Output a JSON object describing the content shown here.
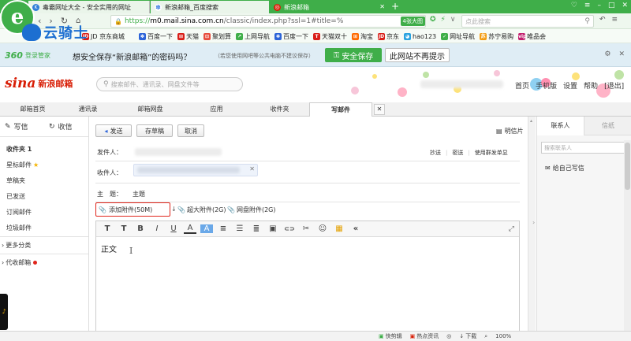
{
  "browser": {
    "tabs": [
      {
        "title": "毒霸网址大全 - 安全实用的网址",
        "icon_color": "#2f7fd8",
        "icon": "K"
      },
      {
        "title": "新浪邮箱_百度搜索",
        "icon_color": "#3a7be0",
        "icon": "✽"
      },
      {
        "title": "新浪邮箱",
        "icon_color": "#d81e06",
        "icon": "◎"
      }
    ],
    "url_prefix": "https://",
    "url_host": "m0.mail.sina.com.cn",
    "url_path": "/classic/index.php?ssl=1#title=%",
    "zoom_badge": "4张大图",
    "search_placeholder": "点此搜索",
    "brand_overlay": "云骑士",
    "bookmarks": [
      {
        "label": "百度一下",
        "color": "#2d64d8",
        "glyph": "✽"
      },
      {
        "label": "天猫",
        "color": "#d91e18",
        "glyph": "⊞"
      },
      {
        "label": "聚划算",
        "color": "#e74c3c",
        "glyph": "⊡"
      },
      {
        "label": "上网导航",
        "color": "#3fae49",
        "glyph": "↗"
      },
      {
        "label": "百度一下",
        "color": "#2d64d8",
        "glyph": "✽"
      },
      {
        "label": "天猫双十",
        "color": "#d91e18",
        "glyph": "T"
      },
      {
        "label": "淘宝",
        "color": "#ff6a00",
        "glyph": "⊞"
      },
      {
        "label": "京东",
        "color": "#d91e18",
        "glyph": "JD"
      },
      {
        "label": "hao123",
        "color": "#2aa3e0",
        "glyph": "◕"
      },
      {
        "label": "网址导航",
        "color": "#3fae49",
        "glyph": "✓"
      },
      {
        "label": "苏宁易购",
        "color": "#f39c12",
        "glyph": "苏"
      },
      {
        "label": "唯品会",
        "color": "#c21d6d",
        "glyph": "vip"
      }
    ],
    "bookmark_partial": "淘宝特卖",
    "bookmark_partial2": "JD 京东商城"
  },
  "security_bar": {
    "logo": "360",
    "logo_sub": "登录管家",
    "question": "想安全保存“新浪邮箱”的密码吗？",
    "note": "（若您使用网吧等公共电脑不建议保存）",
    "save_label": "安全保存",
    "never_label": "此网站不再提示"
  },
  "mail": {
    "logo": "sina",
    "logo_text": "新浪邮箱",
    "search_placeholder": "搜索邮件、通讯录、网盘文件等",
    "top_links": [
      "首页",
      "手机版",
      "设置",
      "帮助",
      "[退出]"
    ],
    "nav_tabs": [
      "邮箱首页",
      "通讯录",
      "邮箱网盘",
      "应用",
      "收件夹",
      "写邮件"
    ],
    "active_tab": "写邮件",
    "write_label": "写信",
    "receive_label": "收信",
    "folders": [
      {
        "label": "收件夹 1",
        "bold": true
      },
      {
        "label": "星标邮件",
        "star": true
      },
      {
        "label": "草稿夹"
      },
      {
        "label": "已发送"
      },
      {
        "label": "订阅邮件"
      },
      {
        "label": "垃圾邮件"
      }
    ],
    "more_label": "更多分类",
    "proxy_label": "代收邮箱",
    "compose": {
      "send": "发送",
      "save_draft": "存草稿",
      "cancel": "取消",
      "postcard": "明信片",
      "from_label": "发件人：",
      "to_label": "收件人：",
      "subject_label": "主　题：",
      "subject_value": "主题",
      "cc": "抄送",
      "bcc": "密送",
      "group_send": "使用群发单显",
      "attach": "添加附件(50M)",
      "big_attach": "超大附件(2G)",
      "disk_attach": "网盘附件(2G)",
      "body": "正文",
      "toolbar": [
        "T",
        "T",
        "B",
        "I",
        "U",
        "A",
        "A",
        "≡",
        "☰",
        "≣",
        "▣",
        "⊂⊃",
        "✂",
        "☺",
        "▦",
        "«"
      ]
    },
    "contacts": {
      "tab1": "联系人",
      "tab2": "信纸",
      "search_placeholder": "搜索联系人",
      "self_mail": "给自己写信"
    }
  },
  "status_bar": {
    "items": [
      "快剪辑",
      "热点资讯",
      "下载"
    ],
    "zoom": "100%"
  },
  "colors": {
    "green": "#3fae49",
    "sina_red": "#d81e06",
    "highlight": "#e0251b"
  }
}
